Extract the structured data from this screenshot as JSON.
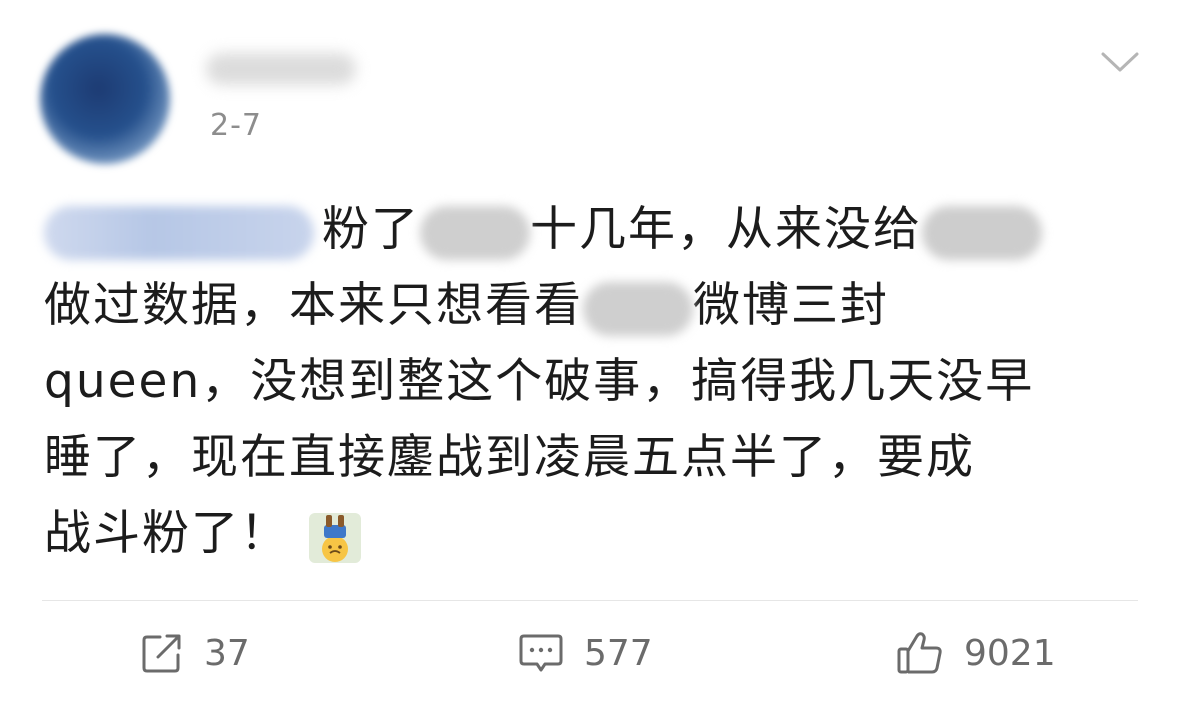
{
  "post": {
    "date": "2-7",
    "lines": {
      "l1_a": "粉了",
      "l1_b": "十几年，从来没给",
      "l2_a": "做过数据，本来只想看看",
      "l2_b": "微博三封",
      "l3": "queen，没想到整这个破事，搞得我几天没早",
      "l4": "睡了，现在直接鏖战到凌晨五点半了，要成",
      "l5": "战斗粉了！"
    }
  },
  "actions": {
    "repost_count": "37",
    "comment_count": "577",
    "like_count": "9021"
  },
  "icons": {
    "more": "chevron-down-icon",
    "repost": "repost-icon",
    "comment": "comment-icon",
    "like": "thumbs-up-icon",
    "emoji": "upside-down-emoji"
  }
}
